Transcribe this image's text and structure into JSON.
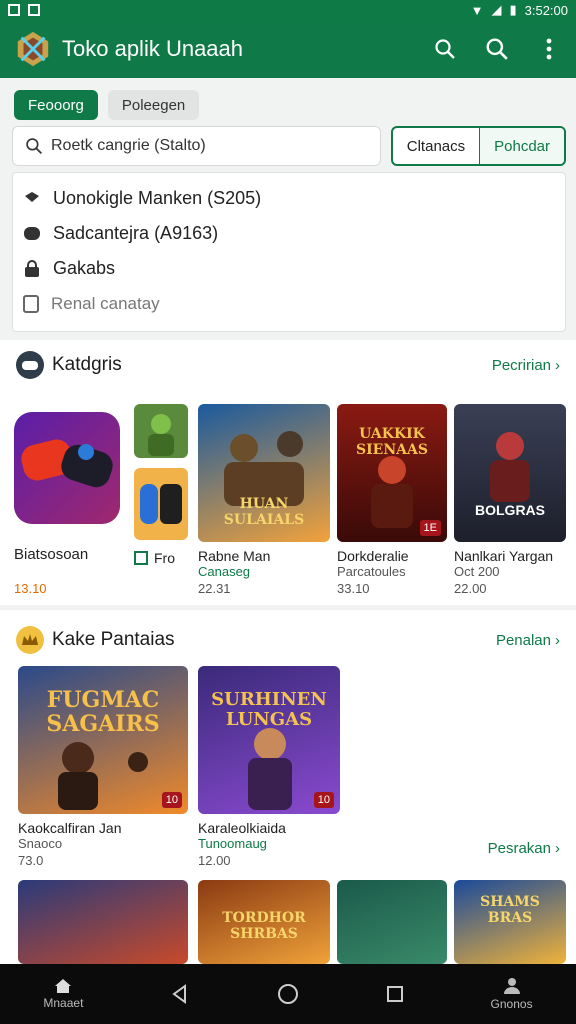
{
  "status": {
    "time": "3:52:00"
  },
  "app": {
    "title": "Toko aplik Unaaah"
  },
  "chips": [
    {
      "label": "Feooorg",
      "active": true
    },
    {
      "label": "Poleegen",
      "active": false
    }
  ],
  "search": {
    "value": "Roetk cangrie (Stalto)"
  },
  "toggle": {
    "left": "Cltanacs",
    "right": "Pohcdar"
  },
  "suggestions": [
    {
      "icon": "shield-icon",
      "label": "Uonokigle Manken (S205)"
    },
    {
      "icon": "bubble-icon",
      "label": "Sadcantejra (A9163)"
    },
    {
      "icon": "lock-icon",
      "label": "Gakabs"
    },
    {
      "icon": "doc-icon",
      "label": "Renal canatay"
    }
  ],
  "section1": {
    "title": "Katdgris",
    "more": "Pecririan",
    "cards": [
      {
        "title": "Biatsosoan",
        "sub": "",
        "price": "13.10"
      },
      {
        "title": "Fro",
        "sub": "",
        "price": ""
      },
      {
        "title": "Rabne Man",
        "sub": "Canaseg",
        "price": "22.31",
        "badge": ""
      },
      {
        "title": "Dorkderalie",
        "sub": "Parcatoules",
        "price": "33.10",
        "badge": "1E"
      },
      {
        "title": "Nanlkari Yargan",
        "sub": "Oct 200",
        "price": "22.00",
        "badge": ""
      }
    ],
    "art": [
      {
        "text": ""
      },
      {
        "text": ""
      },
      {
        "text": "HUAN SULAIALS"
      },
      {
        "text": "UAKKIK SIENAAS"
      },
      {
        "text": "BOLGRAS"
      }
    ]
  },
  "section2": {
    "title": "Kake Pantaias",
    "more": "Penalan",
    "more2": "Pesrakan",
    "cards": [
      {
        "title": "Kaokcalfiran Jan",
        "sub": "Snaoco",
        "price": "73.0",
        "badge": "10",
        "art": "FUGMAC SAGAIRS"
      },
      {
        "title": "Karaleolkiaida",
        "sub": "Tunoomaug",
        "price": "12.00",
        "badge": "10",
        "art": "SURHINEN LUNGAS"
      }
    ],
    "row2": [
      {
        "art": ""
      },
      {
        "art": "TORDHOR SHRBAS"
      },
      {
        "art": ""
      },
      {
        "art": "SHAMS BRAS"
      }
    ]
  },
  "nav": {
    "home": "Mnaaet",
    "profile": "Gnonos"
  },
  "colors": {
    "brand": "#0f7a47",
    "badge": "#a5151b"
  }
}
